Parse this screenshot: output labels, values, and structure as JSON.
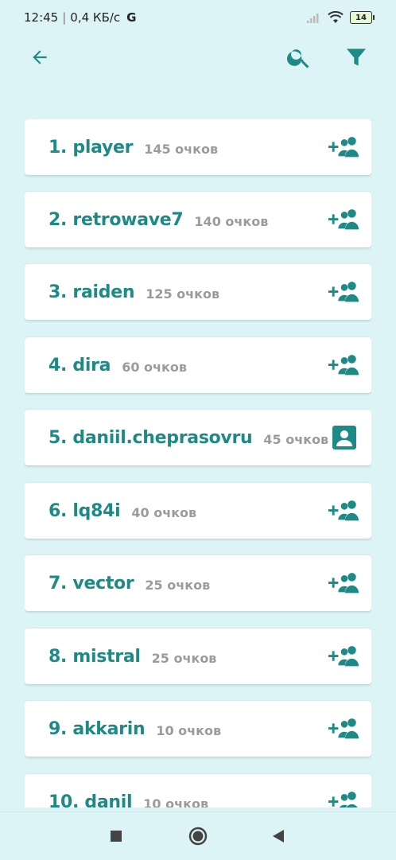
{
  "status_bar": {
    "time": "12:45",
    "speed": "0,4 КБ/с",
    "carrier_icon": "G",
    "battery": "14"
  },
  "toolbar": {
    "back_icon": "arrow-left-icon",
    "search_icon": "search-icon",
    "filter_icon": "filter-icon"
  },
  "players": [
    {
      "rank_name": "1. player",
      "score": "145 очков",
      "action": "add-friend-icon"
    },
    {
      "rank_name": "2. retrowave7",
      "score": "140 очков",
      "action": "add-friend-icon"
    },
    {
      "rank_name": "3. raiden",
      "score": "125 очков",
      "action": "add-friend-icon"
    },
    {
      "rank_name": "4. dira",
      "score": "60 очков",
      "action": "add-friend-icon"
    },
    {
      "rank_name": "5. daniil.cheprasovru",
      "score": "45 очков",
      "action": "contact-card-icon"
    },
    {
      "rank_name": "6. lq84i",
      "score": "40 очков",
      "action": "add-friend-icon"
    },
    {
      "rank_name": "7. vector",
      "score": "25 очков",
      "action": "add-friend-icon"
    },
    {
      "rank_name": "8. mistral",
      "score": "25 очков",
      "action": "add-friend-icon"
    },
    {
      "rank_name": "9. akkarin",
      "score": "10 очков",
      "action": "add-friend-icon"
    },
    {
      "rank_name": "10. danil",
      "score": "10 очков",
      "action": "add-friend-icon"
    }
  ],
  "nav": {
    "recents_icon": "square-icon",
    "home_icon": "circle-icon",
    "back_icon": "triangle-back-icon"
  },
  "colors": {
    "background": "#dcf4f6",
    "accent": "#1e8a86",
    "score_gray": "#9b9b9b"
  }
}
